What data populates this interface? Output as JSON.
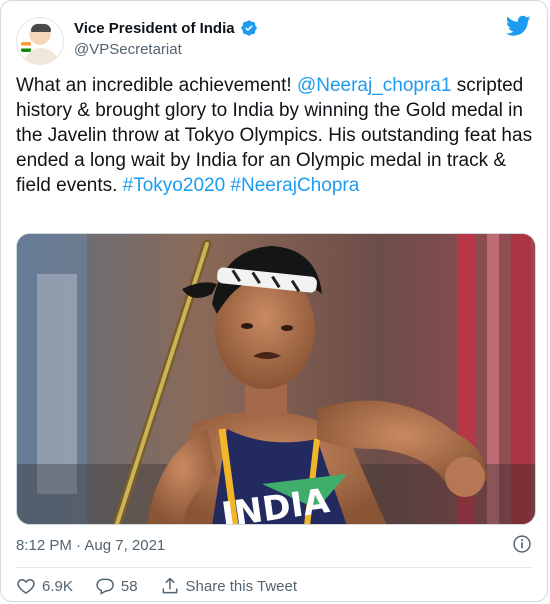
{
  "author": {
    "display_name": "Vice President of India",
    "handle": "@VPSecretariat",
    "verified": true
  },
  "tweet": {
    "text_parts": [
      {
        "text": "What an incredible achievement! ",
        "type": "plain"
      },
      {
        "text": "@Neeraj_chopra1",
        "type": "mention"
      },
      {
        "text": " scripted history & brought glory to India by winning the Gold medal in the Javelin throw at Tokyo Olympics. His outstanding feat has ended a long wait by India for an Olympic medal in track & field events.  ",
        "type": "plain"
      },
      {
        "text": "#Tokyo2020",
        "type": "hashtag"
      },
      {
        "text": " ",
        "type": "plain"
      },
      {
        "text": "#NeerajChopra",
        "type": "hashtag"
      }
    ],
    "jersey_text": "INDIA",
    "timestamp": "8:12 PM · Aug 7, 2021"
  },
  "actions": {
    "likes": "6.9K",
    "replies": "58",
    "share_label": "Share this Tweet"
  },
  "icons": {
    "verified": "verified-badge-icon",
    "brand": "twitter-bird-icon",
    "info": "info-icon",
    "like": "heart-icon",
    "reply": "reply-bubble-icon",
    "share": "share-icon"
  },
  "colors": {
    "brand_blue": "#1d9bf0",
    "text_primary": "#0f1419",
    "text_secondary": "#536471",
    "border": "#cfd9de"
  }
}
